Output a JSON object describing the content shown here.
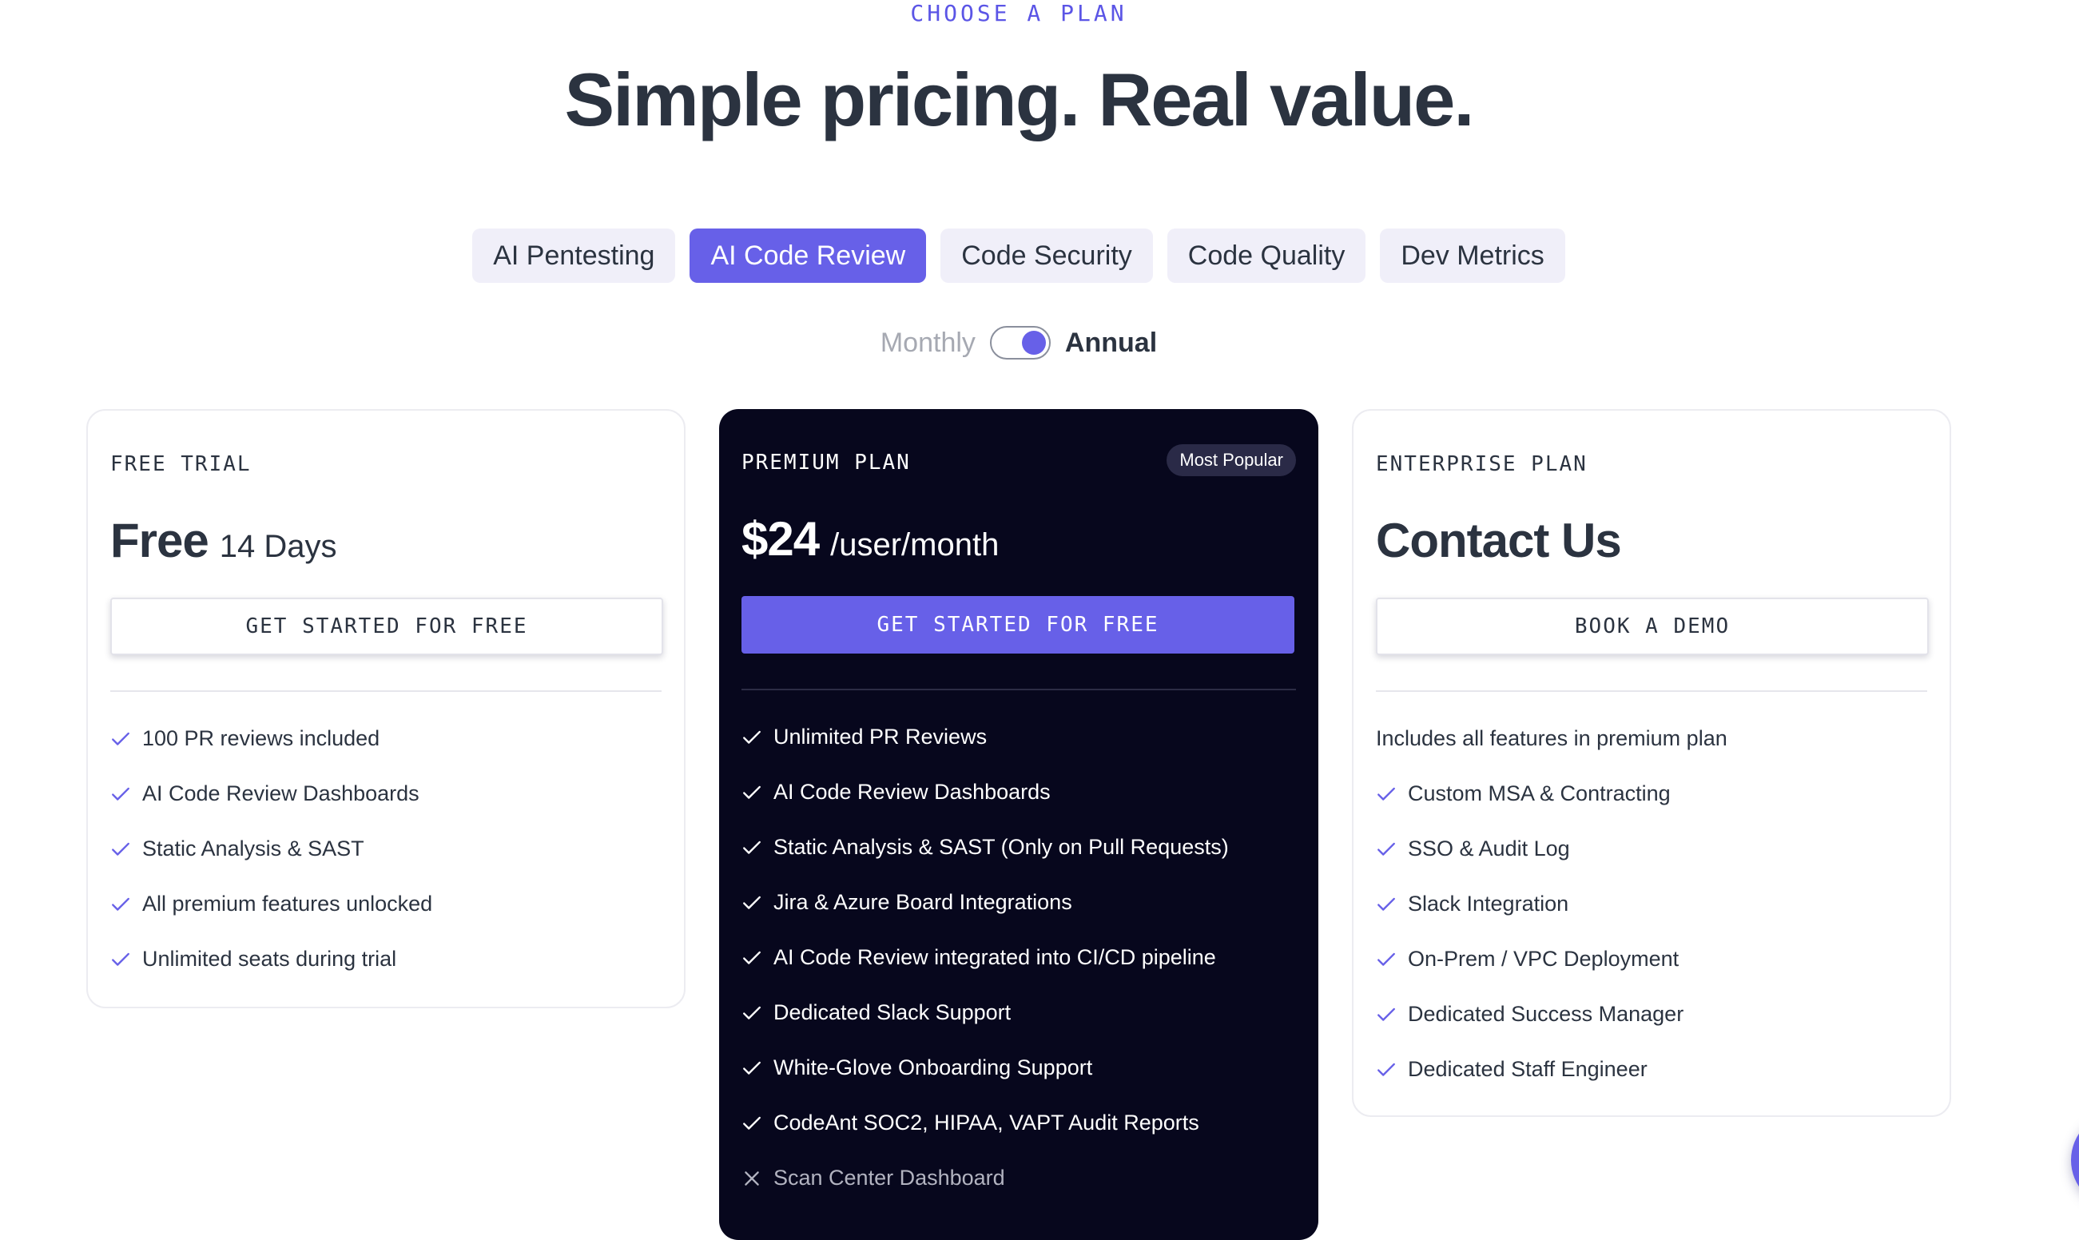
{
  "header": {
    "eyebrow": "CHOOSE A PLAN",
    "title": "Simple pricing. Real value."
  },
  "tabs": [
    {
      "label": "AI Pentesting",
      "active": false
    },
    {
      "label": "AI Code Review",
      "active": true
    },
    {
      "label": "Code Security",
      "active": false
    },
    {
      "label": "Code Quality",
      "active": false
    },
    {
      "label": "Dev Metrics",
      "active": false
    }
  ],
  "billing": {
    "monthly_label": "Monthly",
    "annual_label": "Annual",
    "selected": "Annual"
  },
  "colors": {
    "accent": "#6760e8",
    "dark_card": "#07071d",
    "text": "#2b3340"
  },
  "plans": {
    "free": {
      "label": "FREE TRIAL",
      "price": "Free",
      "price_sub": "14 Days",
      "cta": "GET STARTED FOR FREE",
      "features": [
        "100 PR reviews included",
        "AI Code Review Dashboards",
        "Static Analysis & SAST",
        "All premium features unlocked",
        "Unlimited seats during trial"
      ]
    },
    "premium": {
      "label": "PREMIUM PLAN",
      "badge": "Most Popular",
      "price": "$24",
      "price_sub": "/user/month",
      "cta": "GET STARTED FOR FREE",
      "features": [
        "Unlimited PR Reviews",
        "AI Code Review Dashboards",
        "Static Analysis & SAST (Only on Pull Requests)",
        "Jira & Azure Board Integrations",
        "AI Code Review integrated into CI/CD pipeline",
        "Dedicated Slack Support",
        "White-Glove Onboarding Support",
        "CodeAnt SOC2, HIPAA, VAPT Audit Reports",
        "Scan Center Dashboard"
      ],
      "excluded_feature": "Scan Center Dashboard"
    },
    "enterprise": {
      "label": "ENTERPRISE PLAN",
      "price": "Contact Us",
      "cta": "BOOK A DEMO",
      "intro": "Includes all features in premium plan",
      "features": [
        "Custom MSA & Contracting",
        "SSO & Audit Log",
        "Slack Integration",
        "On-Prem / VPC Deployment",
        "Dedicated Success Manager",
        "Dedicated Staff Engineer"
      ]
    }
  }
}
